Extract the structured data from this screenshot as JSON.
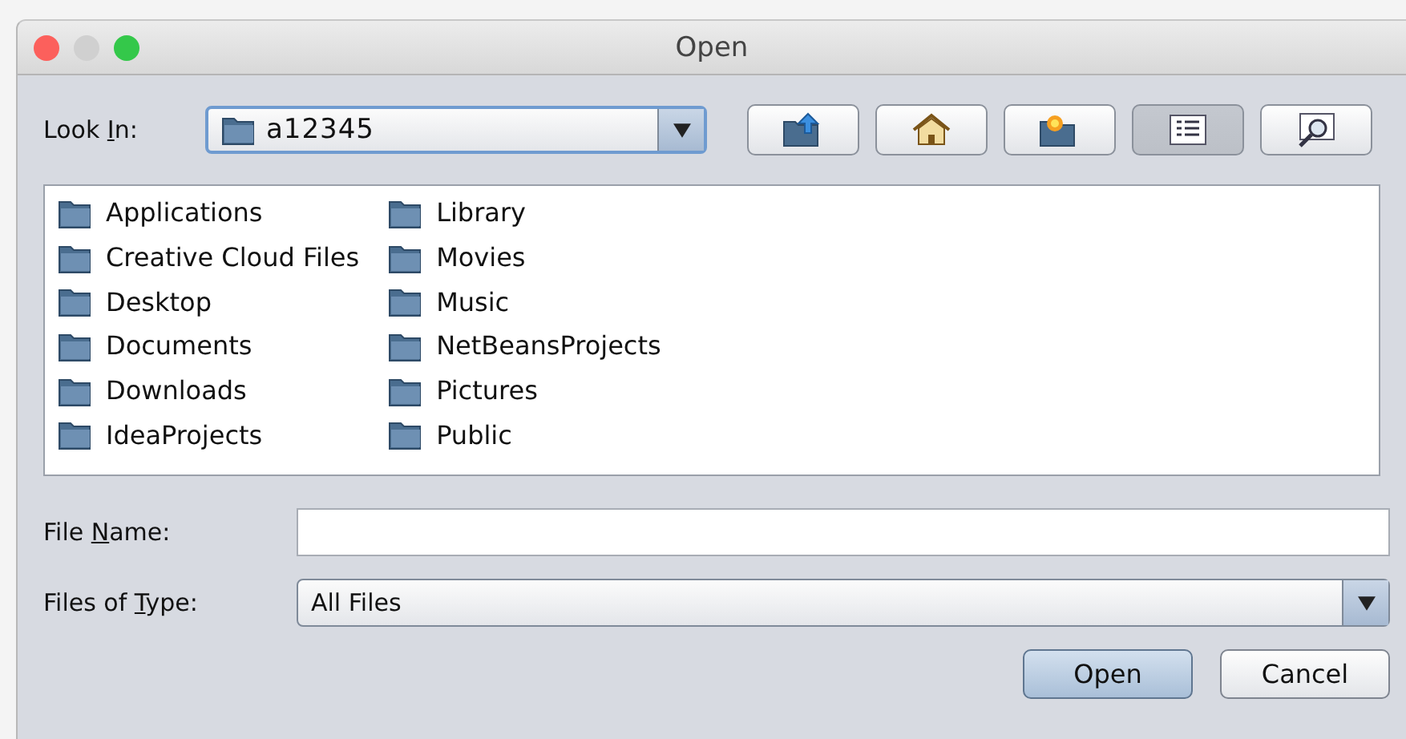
{
  "window": {
    "title": "Open"
  },
  "look_in": {
    "label": {
      "before": "Look ",
      "key": "I",
      "after": "n:"
    },
    "value": "a12345"
  },
  "toolbar": [
    {
      "kind": "up",
      "selected": false
    },
    {
      "kind": "home",
      "selected": false
    },
    {
      "kind": "new-folder",
      "selected": false
    },
    {
      "kind": "list",
      "selected": true
    },
    {
      "kind": "details",
      "selected": false
    }
  ],
  "files": [
    {
      "name": "Applications"
    },
    {
      "name": "Creative Cloud Files"
    },
    {
      "name": "Desktop"
    },
    {
      "name": "Documents"
    },
    {
      "name": "Downloads"
    },
    {
      "name": "IdeaProjects"
    },
    {
      "name": "Library"
    },
    {
      "name": "Movies"
    },
    {
      "name": "Music"
    },
    {
      "name": "NetBeansProjects"
    },
    {
      "name": "Pictures"
    },
    {
      "name": "Public"
    }
  ],
  "file_name": {
    "label": {
      "before": "File ",
      "key": "N",
      "after": "ame:"
    }
  },
  "file_type": {
    "label": {
      "before": "Files of ",
      "key": "T",
      "after": "ype:"
    },
    "value": "All Files"
  },
  "buttons": [
    {
      "label": "Open",
      "default": true
    },
    {
      "label": "Cancel",
      "default": false
    }
  ]
}
